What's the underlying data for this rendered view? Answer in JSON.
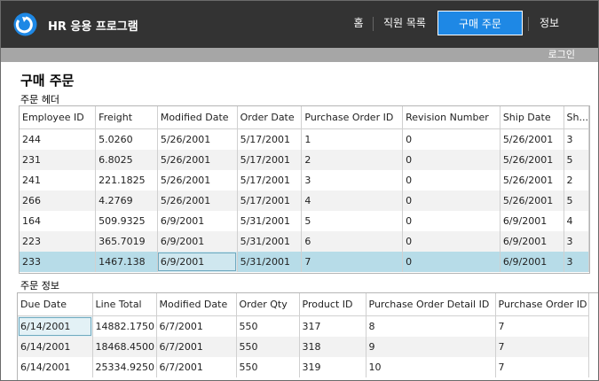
{
  "app": {
    "title": "HR 응용 프로그램",
    "nav": [
      {
        "label": "홈"
      },
      {
        "label": "직원 목록"
      },
      {
        "label": "구매 주문"
      },
      {
        "label": "정보"
      }
    ],
    "active_nav": "구매 주문",
    "login_label": "로그인"
  },
  "colors": {
    "header_bg": "#333333",
    "accent": "#1e88e5",
    "login_bar": "#a6a6a6",
    "selected_row": "#b7dce8"
  },
  "page": {
    "title": "구매 주문",
    "orders_section": "주문 헤더",
    "details_section": "주문 정보"
  },
  "orders": {
    "columns": [
      "Employee ID",
      "Freight",
      "Modified Date",
      "Order Date",
      "Purchase Order ID",
      "Revision Number",
      "Ship Date",
      "Sh..."
    ],
    "rows": [
      [
        "244",
        "5.0260",
        "5/26/2001",
        "5/17/2001",
        "1",
        "0",
        "5/26/2001",
        "3"
      ],
      [
        "231",
        "6.8025",
        "5/26/2001",
        "5/17/2001",
        "2",
        "0",
        "5/26/2001",
        "5"
      ],
      [
        "241",
        "221.1825",
        "5/26/2001",
        "5/17/2001",
        "3",
        "0",
        "5/26/2001",
        "2"
      ],
      [
        "266",
        "4.2769",
        "5/26/2001",
        "5/17/2001",
        "4",
        "0",
        "5/26/2001",
        "5"
      ],
      [
        "164",
        "509.9325",
        "6/9/2001",
        "5/31/2001",
        "5",
        "0",
        "6/9/2001",
        "4"
      ],
      [
        "223",
        "365.7019",
        "6/9/2001",
        "5/31/2001",
        "6",
        "0",
        "6/9/2001",
        "3"
      ],
      [
        "233",
        "1467.138",
        "6/9/2001",
        "5/31/2001",
        "7",
        "0",
        "6/9/2001",
        "3"
      ]
    ],
    "selected_row": 6,
    "focused_col": 2
  },
  "details": {
    "columns": [
      "Due Date",
      "Line Total",
      "Modified Date",
      "Order Qty",
      "Product ID",
      "Purchase Order Detail ID",
      "Purchase Order ID"
    ],
    "rows": [
      [
        "6/14/2001",
        "14882.1750",
        "6/7/2001",
        "550",
        "317",
        "8",
        "7"
      ],
      [
        "6/14/2001",
        "18468.4500",
        "6/7/2001",
        "550",
        "318",
        "9",
        "7"
      ],
      [
        "6/14/2001",
        "25334.9250",
        "6/7/2001",
        "550",
        "319",
        "10",
        "7"
      ]
    ],
    "focused_row": 0,
    "focused_col": 0
  }
}
